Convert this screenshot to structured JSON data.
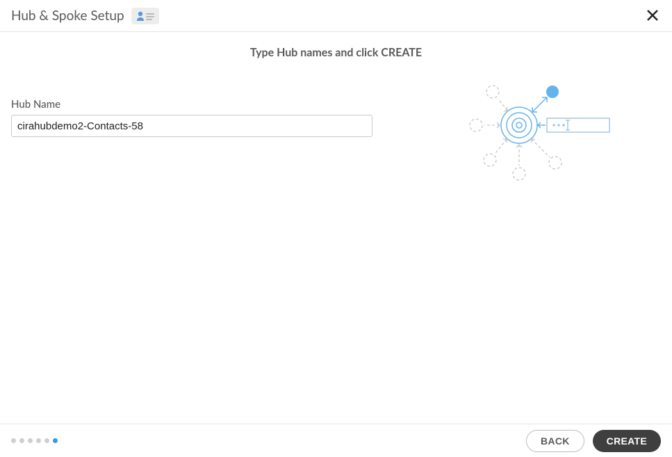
{
  "header": {
    "title": "Hub & Spoke Setup"
  },
  "subtitle": "Type Hub names and click CREATE",
  "form": {
    "hub_name_label": "Hub Name",
    "hub_name_value": "cirahubdemo2-Contacts-58"
  },
  "stepper": {
    "total": 6,
    "active_index": 5
  },
  "buttons": {
    "back": "BACK",
    "create": "CREATE"
  }
}
